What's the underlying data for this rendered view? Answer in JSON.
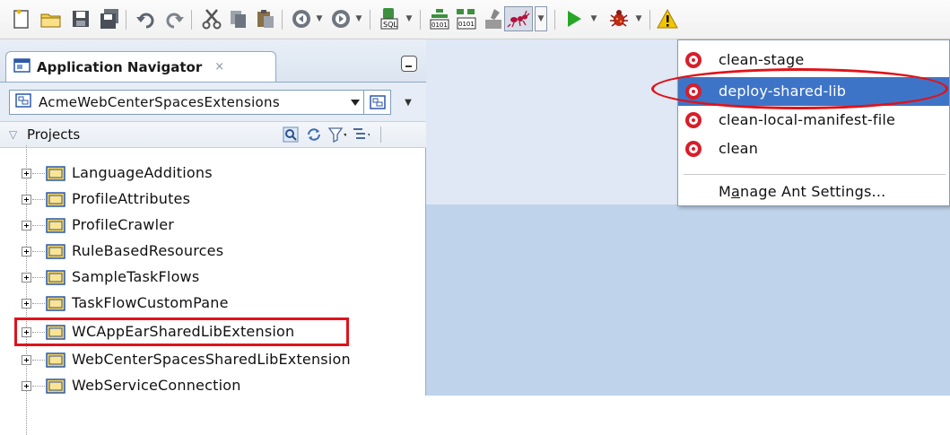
{
  "toolbar": {
    "buttons": [
      "new-icon",
      "open-icon",
      "save-icon",
      "save-all-icon",
      "undo-icon",
      "redo-icon",
      "cut-icon",
      "copy-icon",
      "paste-icon",
      "back-icon",
      "forward-icon",
      "sql-icon",
      "make-icon",
      "rebuild-icon",
      "ant-icon",
      "run-icon",
      "debug-icon",
      "warning-icon"
    ]
  },
  "navigator": {
    "tab_title": "Application Navigator",
    "tab_close": "×",
    "application": "AcmeWebCenterSpacesExtensions",
    "section_label": "Projects",
    "projects": [
      "LanguageAdditions",
      "ProfileAttributes",
      "ProfileCrawler",
      "RuleBasedResources",
      "SampleTaskFlows",
      "TaskFlowCustomPane",
      "WCAppEarSharedLibExtension",
      "WebCenterSpacesSharedLibExtension",
      "WebServiceConnection"
    ],
    "highlighted_project": "WCAppEarSharedLibExtension"
  },
  "ant_menu": {
    "items": [
      "clean-stage",
      "deploy-shared-lib",
      "clean-local-manifest-file",
      "clean"
    ],
    "selected": "deploy-shared-lib",
    "settings_prefix": "",
    "settings_label": "Manage Ant Settings..."
  },
  "colors": {
    "selection": "#3e74c7",
    "annotation": "#e0131a",
    "editor_bg": "#bfd3ea"
  }
}
